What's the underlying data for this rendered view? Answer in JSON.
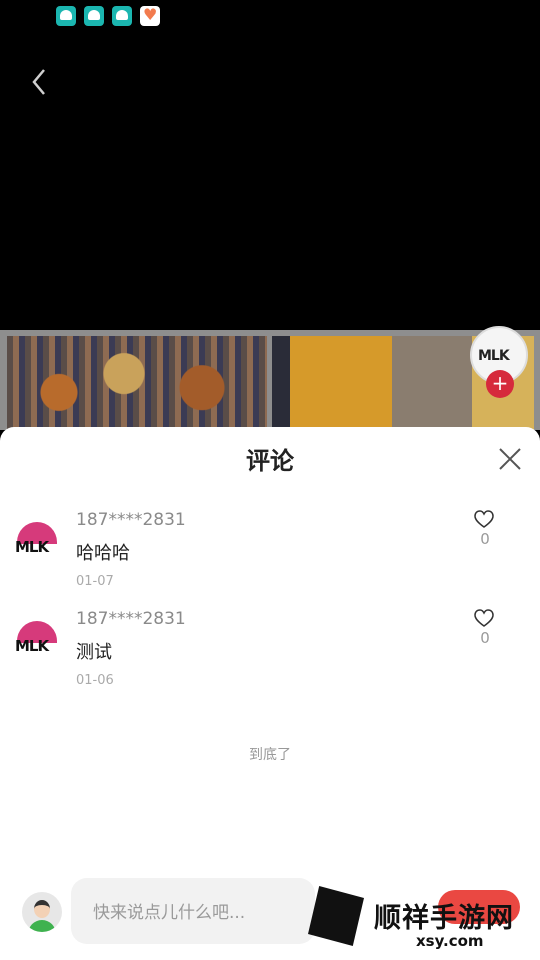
{
  "status_bar": {
    "icons": [
      "app-icon-1",
      "app-icon-2",
      "app-icon-3",
      "heart-app-icon"
    ]
  },
  "video": {
    "back_icon": "chevron-left-icon",
    "creator_logo": "MLK"
  },
  "comments_panel": {
    "title": "评论",
    "close_icon": "close-icon",
    "comments": [
      {
        "user": "187****2831",
        "text": "哈哈哈",
        "date": "01-07",
        "likes": "0",
        "avatar_logo": "MLK"
      },
      {
        "user": "187****2831",
        "text": "测试",
        "date": "01-06",
        "likes": "0",
        "avatar_logo": "MLK"
      }
    ],
    "end_text": "到底了"
  },
  "input_bar": {
    "placeholder": "快来说点儿什么吧..."
  },
  "watermark": {
    "text": "顺祥手游网",
    "url": "xsy.com"
  },
  "colors": {
    "accent_red": "#d62a3c",
    "sheet_bg": "#ffffff",
    "input_bg": "#f2f2f2"
  }
}
